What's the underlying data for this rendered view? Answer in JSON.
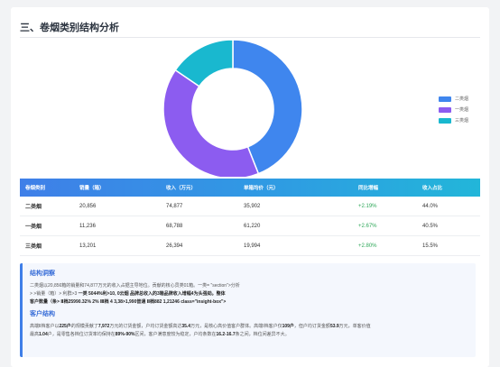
{
  "section": {
    "title": "三、卷烟类别结构分析"
  },
  "chart_data": {
    "type": "pie",
    "donut": true,
    "categories": [
      "二类烟",
      "一类烟",
      "三类烟"
    ],
    "values": [
      44.0,
      40.5,
      15.5
    ],
    "colors": [
      "#3f86ee",
      "#8c5cf0",
      "#19b8cf"
    ],
    "legend": "right"
  },
  "table": {
    "headers": [
      "卷烟类别",
      "销量（箱）",
      "收入（万元）",
      "单箱均价（元）",
      "同比增幅",
      "收入占比"
    ],
    "rows": [
      [
        "二类烟",
        "20,856",
        "74,877",
        "35,902",
        "+2.19%",
        "44.0%"
      ],
      [
        "一类烟",
        "11,236",
        "68,788",
        "61,220",
        "+2.67%",
        "40.5%"
      ],
      [
        "三类烟",
        "13,201",
        "26,394",
        "19,994",
        "+2.80%",
        "15.5%"
      ]
    ]
  },
  "insight": {
    "title": "结构洞察",
    "line1": "二类烟以20,856箱的销量和74,877万元的收入占据主导地位。贡献的核心员类01箱。一类= \"section\">分析",
    "line2a": "> >销量（箱）> 利群>3 ",
    "line2b": "一类 5044%利>10, 0云烟 品牌总收入的3箱品牌收入增幅4为头强劲。整体",
    "line3": "客户数量（条> Ⅱ档25990.32% 2% Ⅲ档 4 3,38>1,990普通 Ⅱ档882 1,21246 class=\"insight-box\">",
    "title2": "客户结构",
    "line4a": "高端Ⅱ档客户以",
    "line4b": "225户",
    "line4c": "的规模贡献了",
    "line4d": "7,972",
    "line4e": "万元的订货金额，户均订货金额高达",
    "line4f": "35.4",
    "line4g": "万元，是核心高价值客户群体。高端Ⅰ档客户仅",
    "line4h": "109户",
    "line4i": "，但户均订货金额",
    "line4j": "53.9",
    "line4k": "万元，单客价值",
    "line5a": "最高",
    "line5b": "1.04",
    "line5c": "户，是零售各档位订货率均保持在",
    "line5d": "89%-90%",
    "line5e": "区间，客户满意度较为稳定，户均条数在",
    "line5f": "16.2-16.7",
    "line5g": "条之间，档位间差异不大。"
  }
}
